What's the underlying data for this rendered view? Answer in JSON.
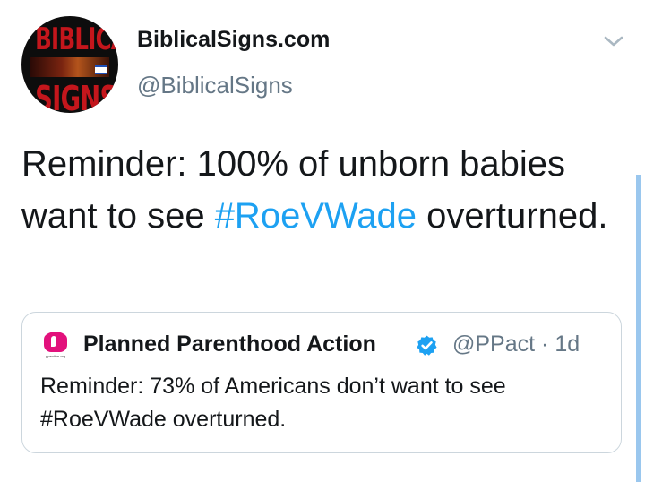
{
  "author": {
    "name": "BiblicalSigns.com",
    "handle": "@BiblicalSigns",
    "avatar_text_top": "BIBLICAL",
    "avatar_text_bottom": "SIGNS"
  },
  "tweet": {
    "text_before": "Reminder: 100% of unborn babies want to see ",
    "hashtag": "#RoeVWade",
    "text_after": " overturned."
  },
  "quoted_tweet": {
    "name": "Planned Parenthood Action",
    "verified": true,
    "handle": "@PPact",
    "separator": "·",
    "time": "1d",
    "avatar_caption": "ppaction.org",
    "text": "Reminder: 73% of Americans don’t want to see #RoeVWade overturned."
  },
  "icons": {
    "menu": "chevron-down-icon",
    "verified": "verified-badge-icon"
  },
  "colors": {
    "link": "#1da1f2",
    "secondary_text": "#657786",
    "verified_badge": "#1da1f2",
    "pp_brand": "#e2117c",
    "avatar_red": "#c4161c"
  }
}
